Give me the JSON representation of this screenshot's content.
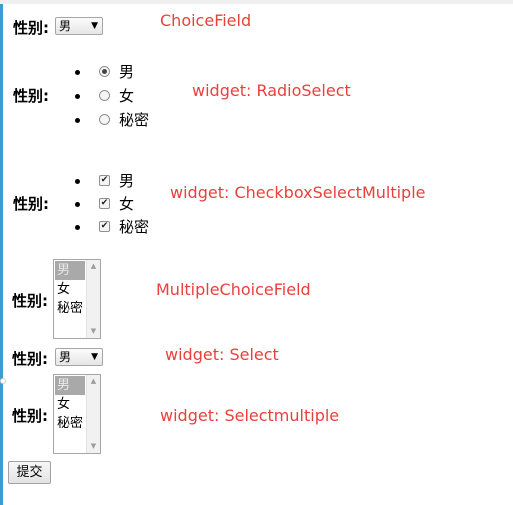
{
  "form": {
    "field_label": "性别:",
    "choice_field": {
      "selected": "男",
      "note": "ChoiceField"
    },
    "radio_select": {
      "note": "widget: RadioSelect",
      "options": [
        {
          "label": "男",
          "checked": true
        },
        {
          "label": "女",
          "checked": false
        },
        {
          "label": "秘密",
          "checked": false
        }
      ]
    },
    "checkbox_select_multiple": {
      "note": "widget: CheckboxSelectMultiple",
      "options": [
        {
          "label": "男",
          "checked": true
        },
        {
          "label": "女",
          "checked": true
        },
        {
          "label": "秘密",
          "checked": true
        }
      ]
    },
    "multiple_choice_field": {
      "note": "MultipleChoiceField",
      "options": [
        {
          "label": "男",
          "selected": true
        },
        {
          "label": "女",
          "selected": false
        },
        {
          "label": "秘密",
          "selected": false
        }
      ]
    },
    "select_widget": {
      "selected": "男",
      "note": "widget: Select"
    },
    "select_multiple": {
      "note": "widget: Selectmultiple",
      "options": [
        {
          "label": "男",
          "selected": true
        },
        {
          "label": "女",
          "selected": false
        },
        {
          "label": "秘密",
          "selected": false
        }
      ]
    },
    "submit_label": "提交"
  },
  "icons": {
    "select_arrow": "dropdown-arrow-icon",
    "scroll_up": "scroll-up-arrow-icon",
    "scroll_down": "scroll-down-arrow-icon",
    "check": "checkmark-icon"
  },
  "colors": {
    "annotation": "#e8413b",
    "left_strip": "#3a9fd0",
    "listbox_selected": "#a9a9a9"
  }
}
